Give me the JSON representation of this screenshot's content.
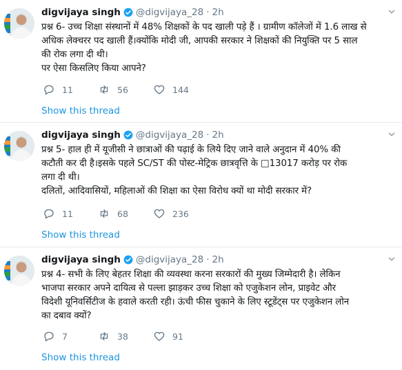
{
  "colors": {
    "link": "#1b95e0",
    "muted": "#657786",
    "text": "#14171a",
    "divider": "#e6ecf0",
    "verified": "#1da1f2"
  },
  "tweets": [
    {
      "author_name": "digvijaya singh",
      "handle": "@digvijaya_28",
      "separator": "·",
      "time": "2h",
      "lines": [
        "प्रश्न 6- उच्च शिक्षा संस्थानों में 48% शिक्षकों के पद खाली पड़े हैं । ग्रामीण कॉलेजों में 1.6 लाख से",
        "अधिक लेक्चरर पद खाली हैं।क्योंकि मोदी जी, आपकी सरकार ने शिक्षकों की नियुक्ति पर 5 साल",
        "की रोक लगा दी थी।",
        "पर ऐसा किसलिए किया आपने?"
      ],
      "replies": "11",
      "retweets": "56",
      "likes": "144",
      "show_thread": "Show this thread"
    },
    {
      "author_name": "digvijaya singh",
      "handle": "@digvijaya_28",
      "separator": "·",
      "time": "2h",
      "lines": [
        "प्रश्न 5- हाल ही में यूजीसी ने छात्राओं की पढ़ाई के लिये दिए जाने वाले अनुदान में 40% की",
        "कटौती कर दी है।इसके पहले SC/ST की पोस्ट-मेट्रिक छात्रवृत्ति के □13017 करोड़ पर रोक",
        "लगा दी थी।",
        "दलितों, आदिवासियों, महिलाओं की शिक्षा का ऐसा विरोध क्यों था मोदी सरकार में?"
      ],
      "replies": "11",
      "retweets": "68",
      "likes": "236",
      "show_thread": "Show this thread"
    },
    {
      "author_name": "digvijaya singh",
      "handle": "@digvijaya_28",
      "separator": "·",
      "time": "2h",
      "lines": [
        "प्रश्न 4- सभी के लिए बेहतर शिक्षा की व्यवस्था करना  सरकारों की मुख्य जिम्मेदारी है। लेकिन",
        "भाजपा सरकार अपने दायित्व  से पल्ला झाड़कर उच्च शिक्षा को एजुकेशन लोन, प्राइवेट और",
        "विदेशी यूनिवर्सिटीज के हवाले करती रही। ऊंची फीस चुकाने के लिए स्टूडेंट्स पर एजुकेशन लोन",
        "का दबाव क्यों?"
      ],
      "replies": "7",
      "retweets": "38",
      "likes": "91",
      "show_thread": "Show this thread"
    }
  ]
}
